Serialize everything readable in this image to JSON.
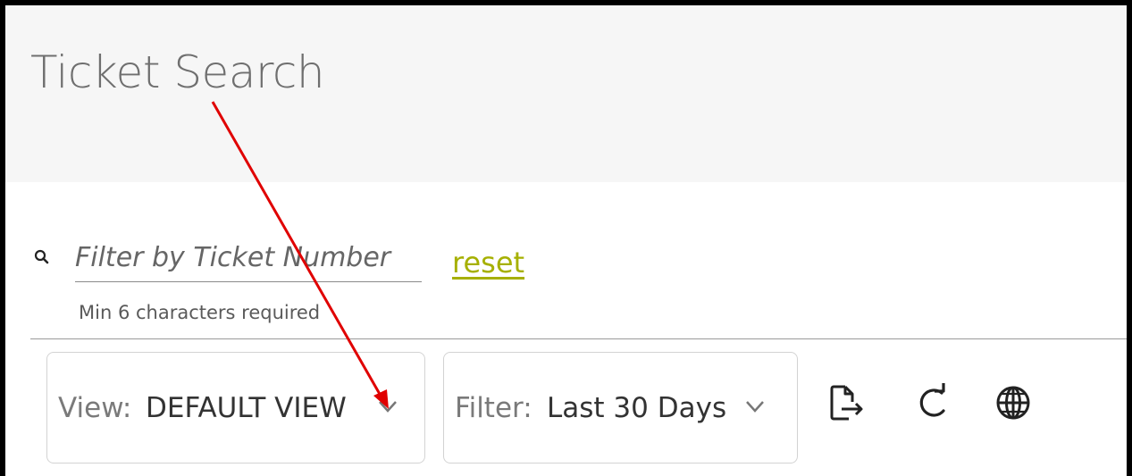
{
  "page": {
    "title": "Ticket Search"
  },
  "search": {
    "icon": "search-icon",
    "placeholder": "Filter by Ticket Number",
    "value": "",
    "hint": "Min 6 characters required",
    "reset_label": "reset"
  },
  "toolbar": {
    "view": {
      "label": "View:",
      "value": "DEFAULT VIEW"
    },
    "filter": {
      "label": "Filter:",
      "value": "Last 30 Days"
    },
    "icons": [
      "export-icon",
      "refresh-icon",
      "globe-icon"
    ]
  },
  "colors": {
    "header_bg": "#f6f6f6",
    "reset_link": "#a6b000",
    "annotation_arrow": "#e00000"
  }
}
